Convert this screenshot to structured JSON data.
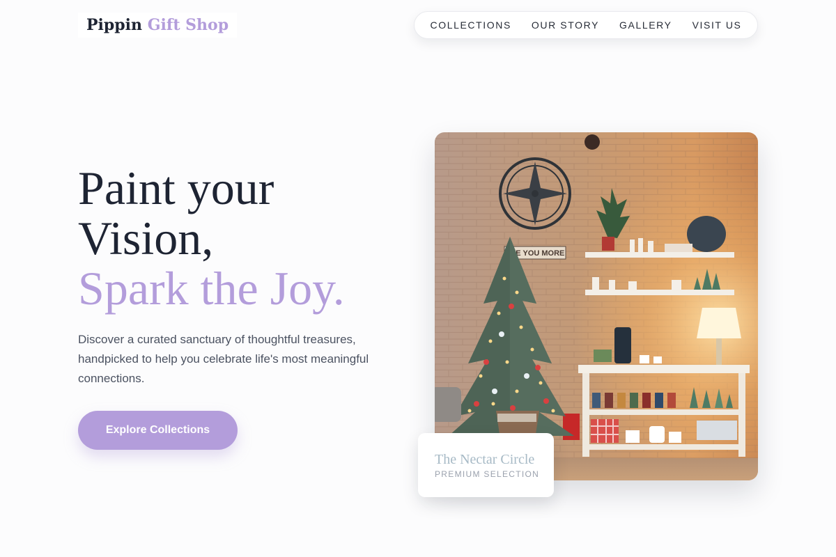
{
  "brand": {
    "name": "Pippin",
    "accent": "Gift Shop",
    "accent_color": "#b39ddb"
  },
  "nav": {
    "items": [
      "COLLECTIONS",
      "OUR STORY",
      "GALLERY",
      "VISIT US"
    ]
  },
  "hero": {
    "title_line1": "Paint your",
    "title_line2": "Vision,",
    "title_line3": "Spark the Joy.",
    "description": "Discover a curated sanctuary of thoughtful treasures, handpicked to help you celebrate life's most meaningful connections.",
    "cta_label": "Explore Collections"
  },
  "photo": {
    "alt": "Cozy shop corner with a decorated Christmas tree, brick wall and shelves of mugs",
    "sign_text": "SEE YOU MORE"
  },
  "featured": {
    "title": "The Nectar Circle",
    "subtitle": "PREMIUM SELECTION"
  },
  "colors": {
    "text_dark": "#1e2433",
    "accent": "#b39ddb",
    "body_text": "#4b5261"
  }
}
